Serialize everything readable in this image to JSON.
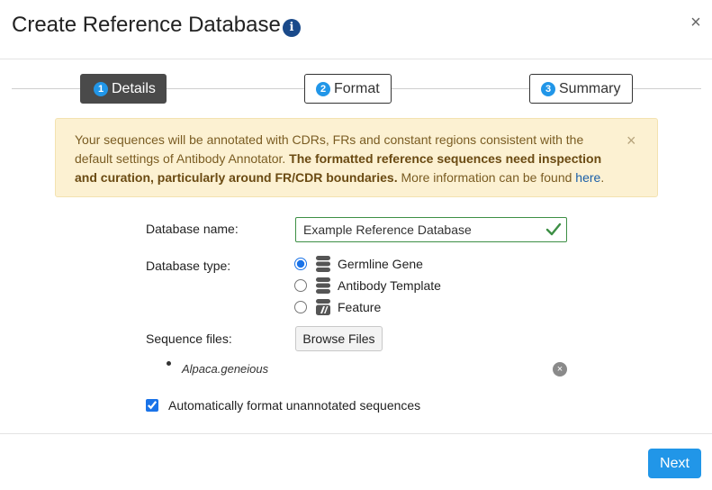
{
  "dialog": {
    "title": "Create Reference Database",
    "info_icon": "i",
    "close_icon": "×"
  },
  "steps": [
    {
      "num": "1",
      "label": "Details",
      "active": true
    },
    {
      "num": "2",
      "label": "Format",
      "active": false
    },
    {
      "num": "3",
      "label": "Summary",
      "active": false
    }
  ],
  "alert": {
    "text_intro": "Your sequences will be annotated with CDRs, FRs and constant regions consistent with the default settings of Antibody Annotator. ",
    "text_bold": "The formatted reference sequences need inspection and curation, particularly around FR/CDR boundaries.",
    "text_more": " More information can be found ",
    "link_text": "here",
    "text_end": ".",
    "close_icon": "×"
  },
  "form": {
    "name_label": "Database name:",
    "name_value": "Example Reference Database",
    "type_label": "Database type:",
    "type_options": [
      {
        "label": "Germline Gene",
        "checked": true,
        "icon": "database-icon"
      },
      {
        "label": "Antibody Template",
        "checked": false,
        "icon": "database-icon"
      },
      {
        "label": "Feature",
        "checked": false,
        "icon": "feature-database-icon"
      }
    ],
    "files_label": "Sequence files:",
    "browse_label": "Browse Files",
    "files": [
      "Alpaca.geneious"
    ],
    "remove_icon": "×",
    "auto_format_label": "Automatically format unannotated sequences",
    "auto_format_checked": true
  },
  "footer": {
    "next_label": "Next"
  },
  "colors": {
    "accent": "#2196e8",
    "alert_bg": "#fcf1d2",
    "valid": "#3d8f45"
  }
}
